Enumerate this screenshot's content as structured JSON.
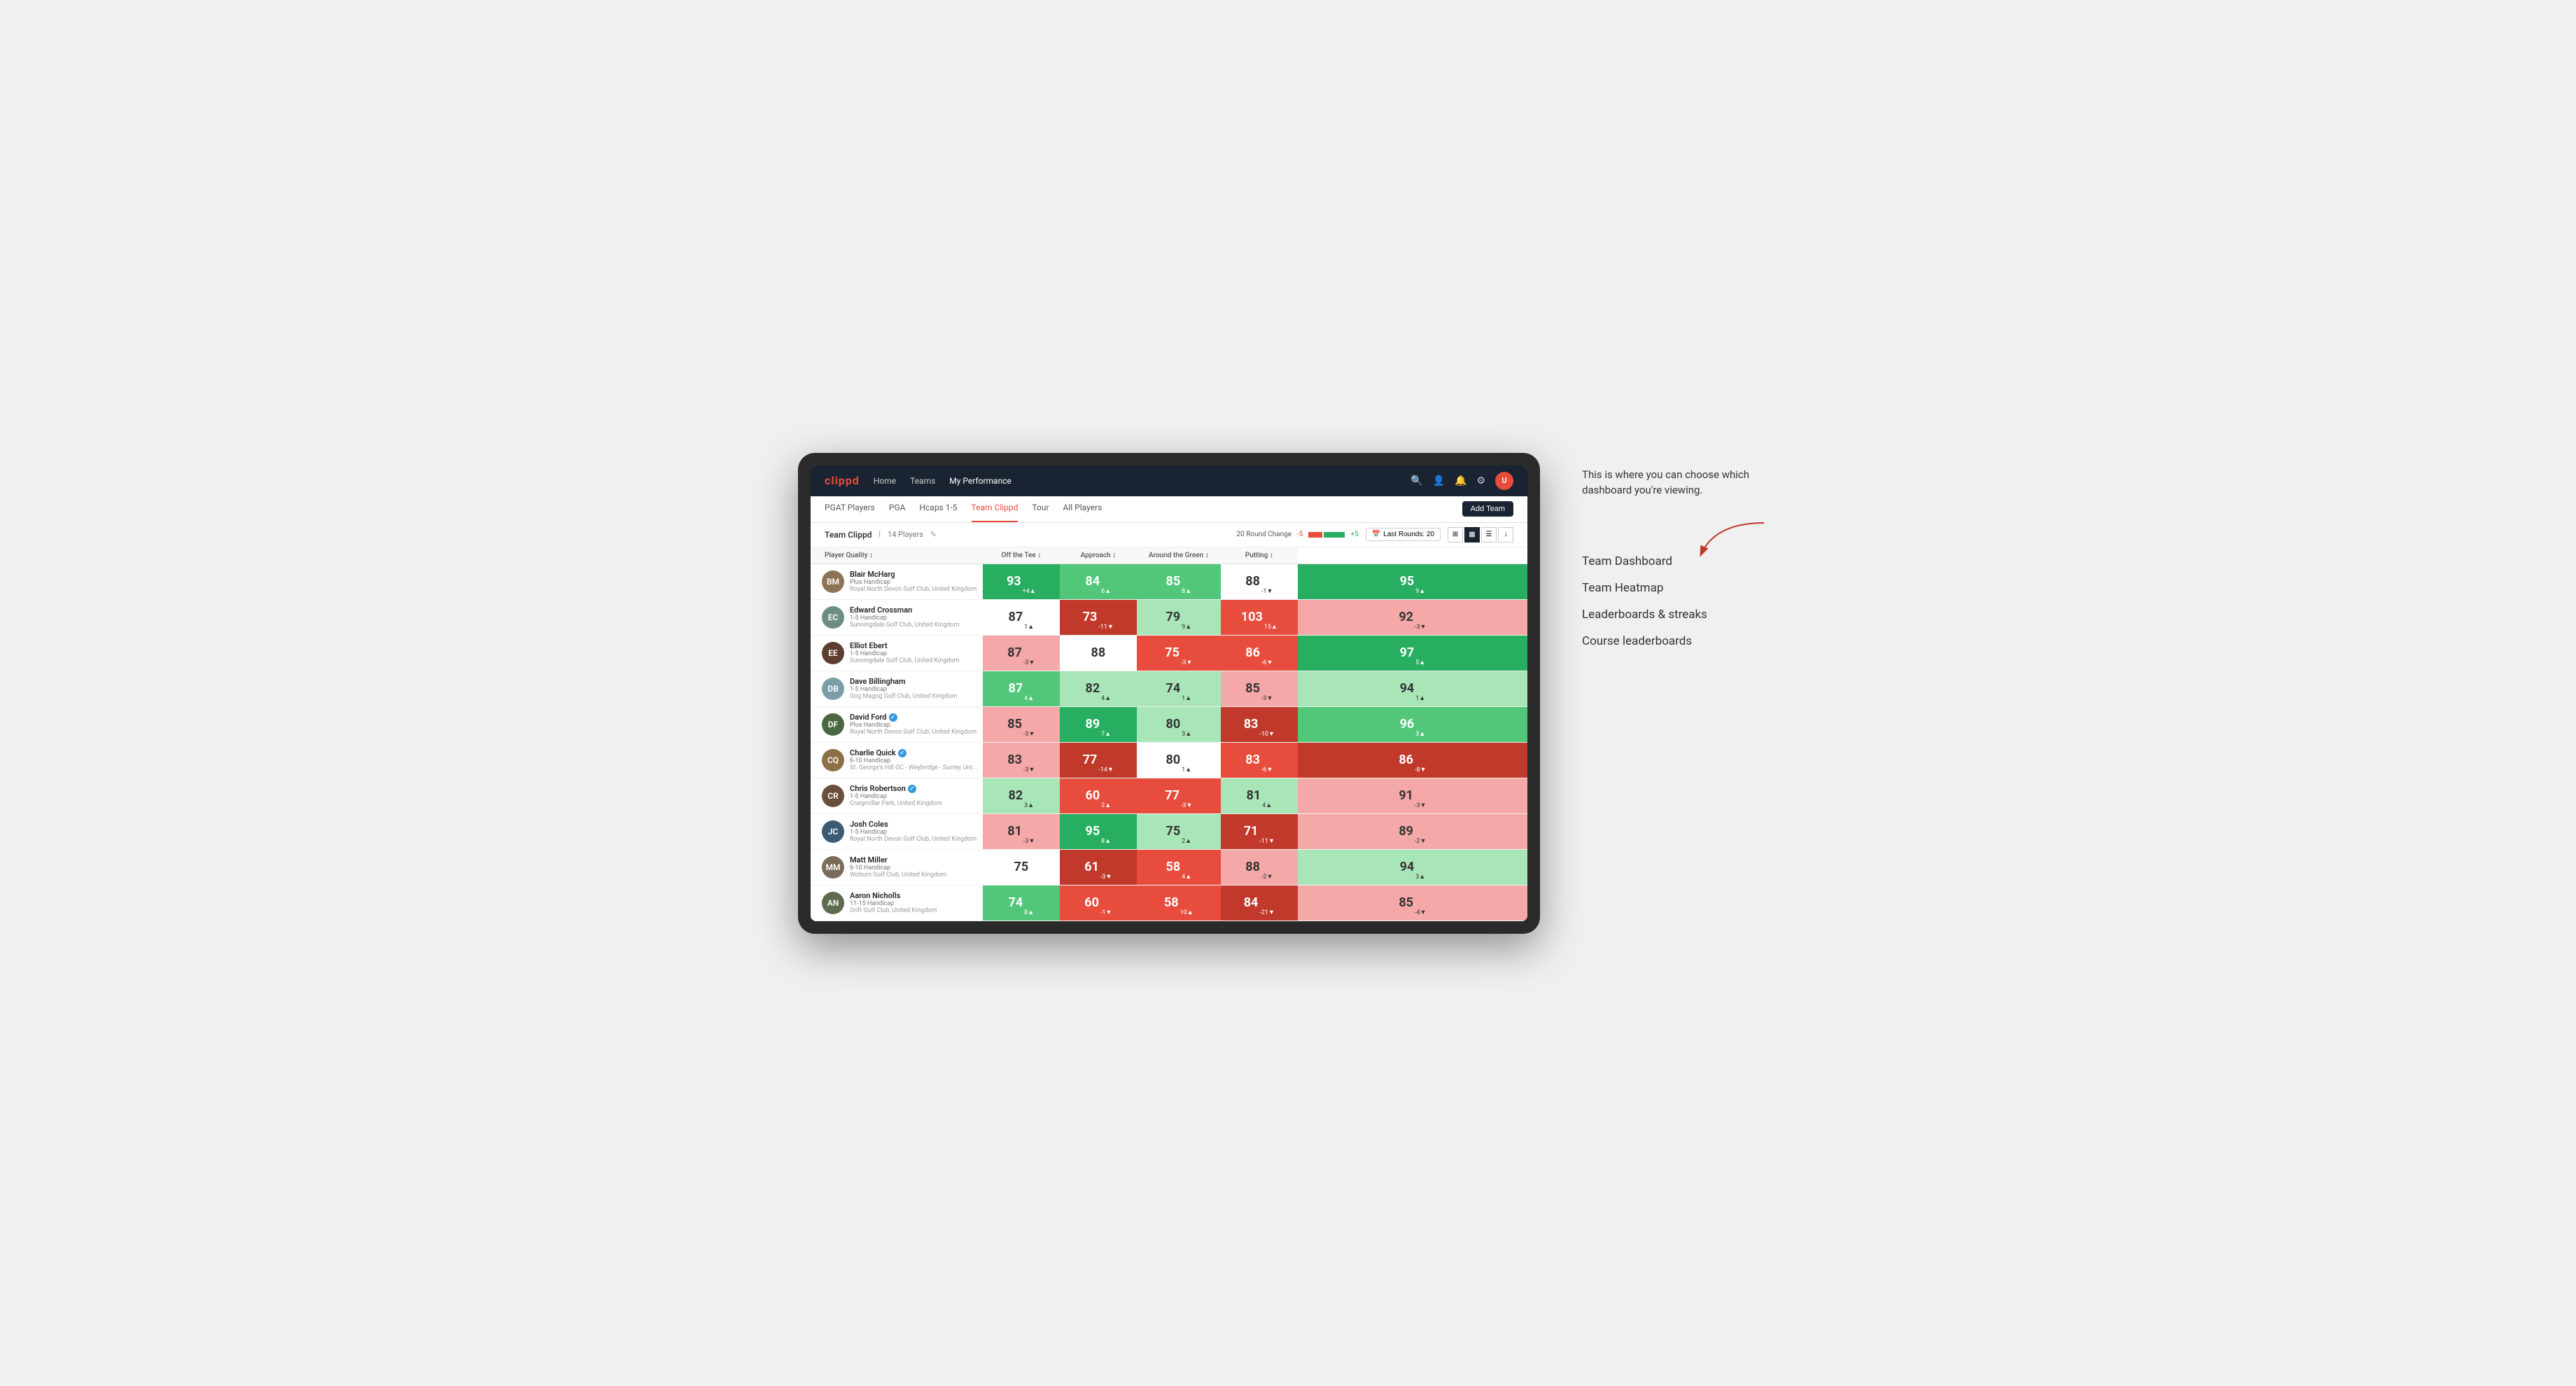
{
  "annotation": {
    "text": "This is where you can choose which dashboard you're viewing.",
    "arrow_direction": "down-left"
  },
  "dashboard_options": [
    {
      "label": "Team Dashboard"
    },
    {
      "label": "Team Heatmap"
    },
    {
      "label": "Leaderboards & streaks"
    },
    {
      "label": "Course leaderboards"
    }
  ],
  "app": {
    "logo": "clippd",
    "nav_links": [
      {
        "label": "Home",
        "active": false
      },
      {
        "label": "Teams",
        "active": false
      },
      {
        "label": "My Performance",
        "active": true
      }
    ],
    "sub_nav_links": [
      {
        "label": "PGAT Players",
        "active": false
      },
      {
        "label": "PGA",
        "active": false
      },
      {
        "label": "Hcaps 1-5",
        "active": false
      },
      {
        "label": "Team Clippd",
        "active": true
      },
      {
        "label": "Tour",
        "active": false
      },
      {
        "label": "All Players",
        "active": false
      }
    ],
    "add_team_label": "Add Team",
    "team_name": "Team Clippd",
    "player_count": "14 Players",
    "round_change_label": "20 Round Change",
    "round_change_low": "-5",
    "round_change_high": "+5",
    "last_rounds_label": "Last Rounds: 20"
  },
  "table": {
    "columns": [
      {
        "label": "Player Quality",
        "sortable": true
      },
      {
        "label": "Off the Tee",
        "sortable": true
      },
      {
        "label": "Approach",
        "sortable": true
      },
      {
        "label": "Around the Green",
        "sortable": true
      },
      {
        "label": "Putting",
        "sortable": true
      }
    ],
    "rows": [
      {
        "name": "Blair McHarg",
        "handicap": "Plus Handicap",
        "club": "Royal North Devon Golf Club, United Kingdom",
        "avatar_color": "#8B7355",
        "avatar_initials": "BM",
        "metrics": [
          {
            "value": 93,
            "change": "+4",
            "direction": "up",
            "bg": "green-dark"
          },
          {
            "value": 84,
            "change": "6",
            "direction": "up",
            "bg": "green-mid"
          },
          {
            "value": 85,
            "change": "8",
            "direction": "up",
            "bg": "green-mid"
          },
          {
            "value": 88,
            "change": "-1",
            "direction": "down",
            "bg": "white"
          },
          {
            "value": 95,
            "change": "9",
            "direction": "up",
            "bg": "green-dark"
          }
        ]
      },
      {
        "name": "Edward Crossman",
        "handicap": "1-5 Handicap",
        "club": "Sunningdale Golf Club, United Kingdom",
        "avatar_color": "#6B8E7F",
        "avatar_initials": "EC",
        "metrics": [
          {
            "value": 87,
            "change": "1",
            "direction": "up",
            "bg": "white"
          },
          {
            "value": 73,
            "change": "-11",
            "direction": "down",
            "bg": "red-dark"
          },
          {
            "value": 79,
            "change": "9",
            "direction": "up",
            "bg": "green-light"
          },
          {
            "value": 103,
            "change": "15",
            "direction": "up",
            "bg": "red-mid"
          },
          {
            "value": 92,
            "change": "-3",
            "direction": "down",
            "bg": "red-light"
          }
        ]
      },
      {
        "name": "Elliot Ebert",
        "handicap": "1-5 Handicap",
        "club": "Sunningdale Golf Club, United Kingdom",
        "avatar_color": "#5C3D2E",
        "avatar_initials": "EE",
        "metrics": [
          {
            "value": 87,
            "change": "-3",
            "direction": "down",
            "bg": "red-light"
          },
          {
            "value": 88,
            "change": "",
            "direction": "none",
            "bg": "white"
          },
          {
            "value": 75,
            "change": "-3",
            "direction": "down",
            "bg": "red-mid"
          },
          {
            "value": 86,
            "change": "-6",
            "direction": "down",
            "bg": "red-mid"
          },
          {
            "value": 97,
            "change": "5",
            "direction": "up",
            "bg": "green-dark"
          }
        ]
      },
      {
        "name": "Dave Billingham",
        "handicap": "1-5 Handicap",
        "club": "Gog Magog Golf Club, United Kingdom",
        "avatar_color": "#7B9EA6",
        "avatar_initials": "DB",
        "metrics": [
          {
            "value": 87,
            "change": "4",
            "direction": "up",
            "bg": "green-mid"
          },
          {
            "value": 82,
            "change": "4",
            "direction": "up",
            "bg": "green-light"
          },
          {
            "value": 74,
            "change": "1",
            "direction": "up",
            "bg": "green-light"
          },
          {
            "value": 85,
            "change": "-3",
            "direction": "down",
            "bg": "red-light"
          },
          {
            "value": 94,
            "change": "1",
            "direction": "up",
            "bg": "green-light"
          }
        ]
      },
      {
        "name": "David Ford",
        "handicap": "Plus Handicap",
        "club": "Royal North Devon Golf Club, United Kingdom",
        "avatar_color": "#4A6741",
        "avatar_initials": "DF",
        "verified": true,
        "metrics": [
          {
            "value": 85,
            "change": "-3",
            "direction": "down",
            "bg": "red-light"
          },
          {
            "value": 89,
            "change": "7",
            "direction": "up",
            "bg": "green-dark"
          },
          {
            "value": 80,
            "change": "3",
            "direction": "up",
            "bg": "green-light"
          },
          {
            "value": 83,
            "change": "-10",
            "direction": "down",
            "bg": "red-dark"
          },
          {
            "value": 96,
            "change": "3",
            "direction": "up",
            "bg": "green-mid"
          }
        ]
      },
      {
        "name": "Charlie Quick",
        "handicap": "6-10 Handicap",
        "club": "St. George's Hill GC - Weybridge - Surrey, Uni...",
        "avatar_color": "#8B6F47",
        "avatar_initials": "CQ",
        "verified": true,
        "metrics": [
          {
            "value": 83,
            "change": "-3",
            "direction": "down",
            "bg": "red-light"
          },
          {
            "value": 77,
            "change": "-14",
            "direction": "down",
            "bg": "red-dark"
          },
          {
            "value": 80,
            "change": "1",
            "direction": "up",
            "bg": "white"
          },
          {
            "value": 83,
            "change": "-6",
            "direction": "down",
            "bg": "red-mid"
          },
          {
            "value": 86,
            "change": "-8",
            "direction": "down",
            "bg": "red-dark"
          }
        ]
      },
      {
        "name": "Chris Robertson",
        "handicap": "1-5 Handicap",
        "club": "Craigmillar Park, United Kingdom",
        "avatar_color": "#6B4E3D",
        "avatar_initials": "CR",
        "verified": true,
        "metrics": [
          {
            "value": 82,
            "change": "3",
            "direction": "up",
            "bg": "green-light"
          },
          {
            "value": 60,
            "change": "2",
            "direction": "up",
            "bg": "red-mid"
          },
          {
            "value": 77,
            "change": "-3",
            "direction": "down",
            "bg": "red-mid"
          },
          {
            "value": 81,
            "change": "4",
            "direction": "up",
            "bg": "green-light"
          },
          {
            "value": 91,
            "change": "-3",
            "direction": "down",
            "bg": "red-light"
          }
        ]
      },
      {
        "name": "Josh Coles",
        "handicap": "1-5 Handicap",
        "club": "Royal North Devon Golf Club, United Kingdom",
        "avatar_color": "#3D5A73",
        "avatar_initials": "JC",
        "metrics": [
          {
            "value": 81,
            "change": "-3",
            "direction": "down",
            "bg": "red-light"
          },
          {
            "value": 95,
            "change": "8",
            "direction": "up",
            "bg": "green-dark"
          },
          {
            "value": 75,
            "change": "2",
            "direction": "up",
            "bg": "green-light"
          },
          {
            "value": 71,
            "change": "-11",
            "direction": "down",
            "bg": "red-dark"
          },
          {
            "value": 89,
            "change": "-2",
            "direction": "down",
            "bg": "red-light"
          }
        ]
      },
      {
        "name": "Matt Miller",
        "handicap": "6-10 Handicap",
        "club": "Woburn Golf Club, United Kingdom",
        "avatar_color": "#7A6B5A",
        "avatar_initials": "MM",
        "metrics": [
          {
            "value": 75,
            "change": "",
            "direction": "none",
            "bg": "white"
          },
          {
            "value": 61,
            "change": "-3",
            "direction": "down",
            "bg": "red-dark"
          },
          {
            "value": 58,
            "change": "4",
            "direction": "up",
            "bg": "red-mid"
          },
          {
            "value": 88,
            "change": "-2",
            "direction": "down",
            "bg": "red-light"
          },
          {
            "value": 94,
            "change": "3",
            "direction": "up",
            "bg": "green-light"
          }
        ]
      },
      {
        "name": "Aaron Nicholls",
        "handicap": "11-15 Handicap",
        "club": "Drift Golf Club, United Kingdom",
        "avatar_color": "#5D6B4E",
        "avatar_initials": "AN",
        "metrics": [
          {
            "value": 74,
            "change": "8",
            "direction": "up",
            "bg": "green-mid"
          },
          {
            "value": 60,
            "change": "-1",
            "direction": "down",
            "bg": "red-mid"
          },
          {
            "value": 58,
            "change": "10",
            "direction": "up",
            "bg": "red-mid"
          },
          {
            "value": 84,
            "change": "-21",
            "direction": "down",
            "bg": "red-dark"
          },
          {
            "value": 85,
            "change": "-4",
            "direction": "down",
            "bg": "red-light"
          }
        ]
      }
    ]
  }
}
